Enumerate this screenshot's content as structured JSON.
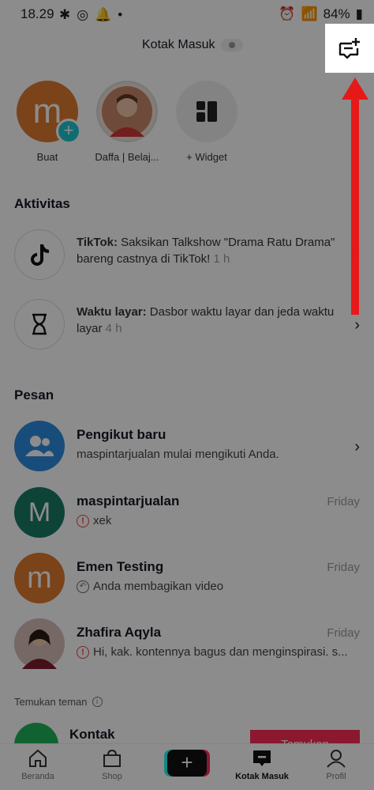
{
  "status_bar": {
    "time": "18.29",
    "battery": "84%"
  },
  "header": {
    "title": "Kotak Masuk"
  },
  "stories": [
    {
      "label": "Buat",
      "avatar_letter": "m"
    },
    {
      "label": "Daffa | Belaj..."
    },
    {
      "label": "+ Widget"
    }
  ],
  "activity": {
    "title": "Aktivitas",
    "items": [
      {
        "label": "TikTok:",
        "text": " Saksikan Talkshow \"Drama Ratu Drama\" bareng castnya di TikTok!",
        "time": " 1 h"
      },
      {
        "label": "Waktu layar:",
        "text": " Dasbor waktu layar dan jeda waktu layar",
        "time": " 4 h"
      }
    ]
  },
  "messages": {
    "title": "Pesan",
    "items": [
      {
        "name": "Pengikut baru",
        "sub": "maspintarjualan mulai mengikuti Anda.",
        "time": ""
      },
      {
        "name": "maspintarjualan",
        "letter": "M",
        "sub": "xek",
        "time": "Friday"
      },
      {
        "name": "Emen Testing",
        "letter": "m",
        "sub": "Anda membagikan video",
        "time": "Friday"
      },
      {
        "name": "Zhafira Aqyla",
        "sub": "Hi, kak. kontennya bagus dan menginspirasi. s...",
        "time": "Friday"
      }
    ]
  },
  "find_friends": {
    "title": "Temukan teman",
    "contact": "Kontak",
    "button": "Temukan"
  },
  "tabs": [
    {
      "label": "Beranda"
    },
    {
      "label": "Shop"
    },
    {
      "label": ""
    },
    {
      "label": "Kotak Masuk"
    },
    {
      "label": "Profil"
    }
  ],
  "colors": {
    "accent": "#fe2c55",
    "annotation_arrow": "#e61919"
  }
}
